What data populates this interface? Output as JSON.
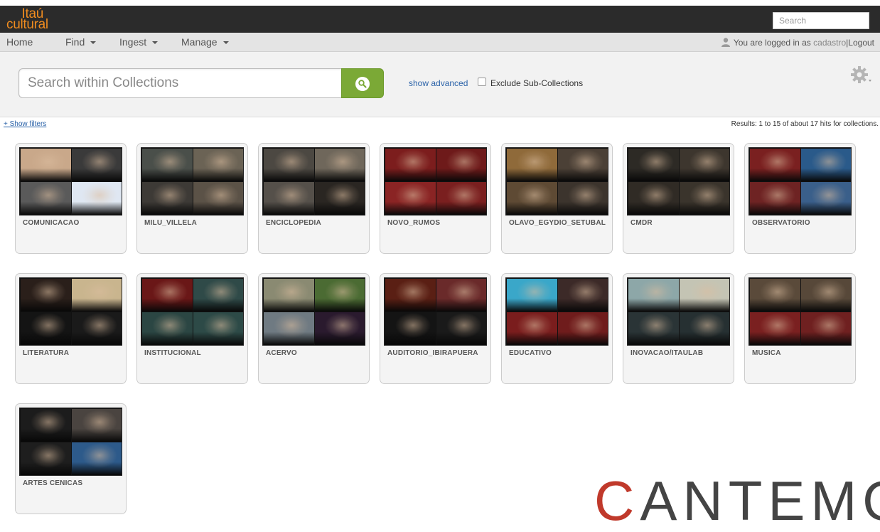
{
  "brand": {
    "line1": "Itaú",
    "line2": "cultural",
    "color": "#f08c1f"
  },
  "top_search": {
    "placeholder": "Search"
  },
  "nav": {
    "home": "Home",
    "find": "Find",
    "ingest": "Ingest",
    "manage": "Manage",
    "logged_in_prefix": "You are logged in as",
    "username": "cadastro",
    "separator": "|",
    "logout": "Logout"
  },
  "search": {
    "placeholder": "Search within Collections",
    "show_advanced": "show advanced",
    "exclude_sub": "Exclude Sub-Collections",
    "exclude_checked": false,
    "button_color": "#7ba936"
  },
  "filters": {
    "show_filters": "+ Show filters"
  },
  "results_text": "Results: 1 to 15 of about 17 hits for collections.",
  "collections": [
    {
      "label": "COMUNICACAO",
      "colors": [
        "#c9a88a",
        "#3a3a3a",
        "#5a5a5a",
        "#dfe7f2"
      ]
    },
    {
      "label": "MILU_VILLELA",
      "colors": [
        "#4a4f4a",
        "#6b6355",
        "#3d3a36",
        "#5b5247"
      ]
    },
    {
      "label": "ENCICLOPEDIA",
      "colors": [
        "#4c4842",
        "#6f675b",
        "#55504a",
        "#2a2622"
      ]
    },
    {
      "label": "NOVO_RUMOS",
      "colors": [
        "#7c1d1d",
        "#6e1a1a",
        "#8a2424",
        "#7a1f1f"
      ]
    },
    {
      "label": "OLAVO_EGYDIO_SETUBAL",
      "colors": [
        "#8f6a3a",
        "#4b4036",
        "#5e4a34",
        "#3c342d"
      ]
    },
    {
      "label": "CMDR",
      "colors": [
        "#2d2a25",
        "#3d362e",
        "#302b25",
        "#3a342c"
      ]
    },
    {
      "label": "OBSERVATORIO",
      "colors": [
        "#7a2020",
        "#2a5a8a",
        "#6e2323",
        "#3a5f8a"
      ]
    },
    {
      "label": "LITERATURA",
      "colors": [
        "#2a1f1a",
        "#c9b58e",
        "#141414",
        "#1a1a1a"
      ]
    },
    {
      "label": "INSTITUCIONAL",
      "colors": [
        "#6a1717",
        "#2f4a48",
        "#2b4643",
        "#2d4a47"
      ]
    },
    {
      "label": "ACERVO",
      "colors": [
        "#8a8a72",
        "#4b6b33",
        "#6f7a82",
        "#2a1a2e"
      ]
    },
    {
      "label": "AUDITORIO_IBIRAPUERA",
      "colors": [
        "#5a1f14",
        "#6a2a2a",
        "#141414",
        "#1a1a1a"
      ]
    },
    {
      "label": "EDUCATIVO",
      "colors": [
        "#3aa7c9",
        "#3c2a28",
        "#7a1d1d",
        "#6f1c1c"
      ]
    },
    {
      "label": "INOVACAO/ITAULAB",
      "colors": [
        "#8da7a8",
        "#c4c4b4",
        "#2a3436",
        "#263032"
      ]
    },
    {
      "label": "MUSICA",
      "colors": [
        "#5a4a3a",
        "#574839",
        "#7a2020",
        "#6f2020"
      ]
    },
    {
      "label": "ARTES CENICAS",
      "colors": [
        "#1c1c1c",
        "#4a4440",
        "#1e1e1e",
        "#2d5a8a"
      ]
    }
  ],
  "watermark": {
    "first": "C",
    "rest": "ANTEMO"
  }
}
